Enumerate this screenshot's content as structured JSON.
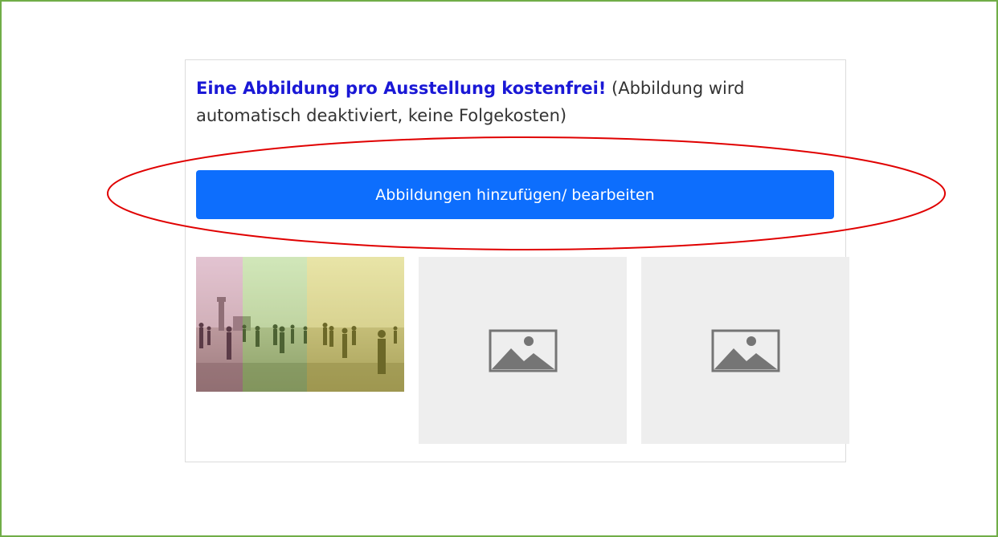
{
  "intro": {
    "highlight": "Eine Abbildung pro Ausstellung kostenfrei!",
    "note": " (Abbildung wird automatisch deaktiviert, keine Folgekosten)"
  },
  "button": {
    "label": "Abbildungen hinzufügen/ bearbeiten"
  },
  "colors": {
    "frame_border": "#70ad47",
    "highlight_text": "#1a18d6",
    "button_background": "#0d6efd",
    "annotation_ellipse": "#e00000",
    "placeholder_background": "#eeeeee",
    "placeholder_icon": "#757575"
  },
  "thumbnails": [
    {
      "kind": "photo",
      "icon": "beach-photo"
    },
    {
      "kind": "placeholder",
      "icon": "image-placeholder-icon"
    },
    {
      "kind": "placeholder",
      "icon": "image-placeholder-icon"
    }
  ]
}
